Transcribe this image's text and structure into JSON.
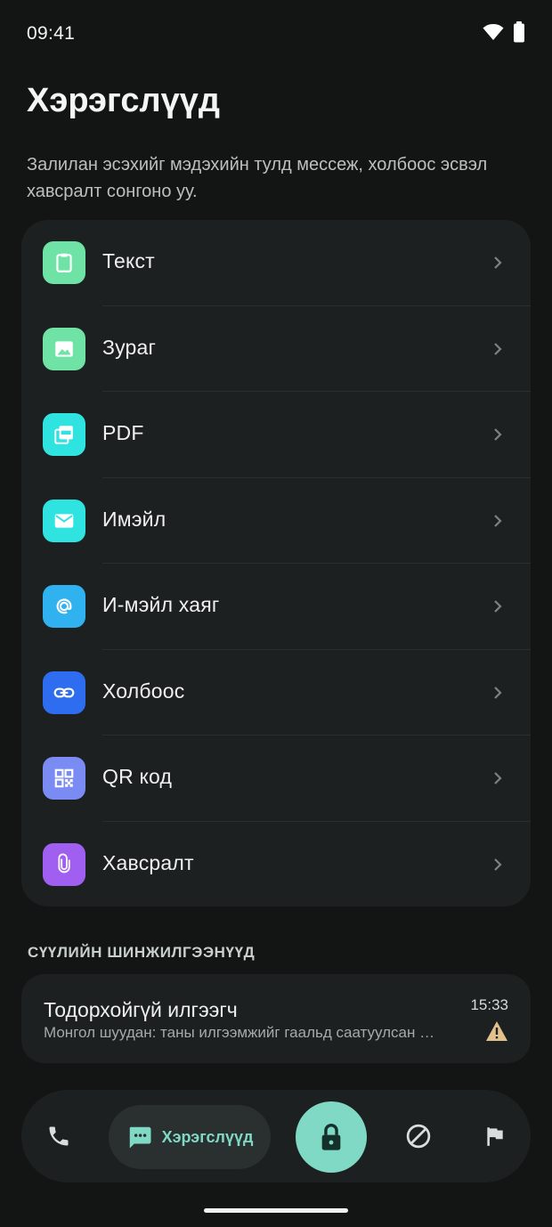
{
  "status_bar": {
    "time": "09:41"
  },
  "page": {
    "title": "Хэрэгслүүд",
    "description": "Залилан эсэхийг мэдэхийн тулд мессеж, холбоос эсвэл хавсралт сонгоно уу."
  },
  "tools": [
    {
      "label": "Текст",
      "icon": "clipboard-icon",
      "color": "#6fe3a6"
    },
    {
      "label": "Зураг",
      "icon": "image-icon",
      "color": "#6fe3a6"
    },
    {
      "label": "PDF",
      "icon": "pdf-icon",
      "color": "#2fe3e0"
    },
    {
      "label": "Имэйл",
      "icon": "mail-icon",
      "color": "#2fe3e0"
    },
    {
      "label": "И-мэйл хаяг",
      "icon": "at-sign-icon",
      "color": "#2fb2ef"
    },
    {
      "label": "Холбоос",
      "icon": "link-icon",
      "color": "#2f6df0"
    },
    {
      "label": "QR код",
      "icon": "qr-code-icon",
      "color": "#7a8cf3"
    },
    {
      "label": "Хавсралт",
      "icon": "paperclip-icon",
      "color": "#a05ff0"
    }
  ],
  "recent": {
    "header": "СҮҮЛИЙН ШИНЖИЛГЭЭНҮҮД",
    "items": [
      {
        "sender": "Тодорхойгүй илгээгч",
        "preview": "Монгол шуудан: таны илгээмжийг гаальд саатуулсан байна",
        "time": "15:33",
        "status_icon": "warning-icon",
        "status_color": "#e3c18c"
      }
    ]
  },
  "nav": {
    "active_label": "Хэрэгслүүд",
    "accent": "#7fd9c4",
    "items": [
      "phone-icon",
      "tools-chat-icon",
      "lock-icon",
      "block-icon",
      "flag-icon"
    ]
  }
}
